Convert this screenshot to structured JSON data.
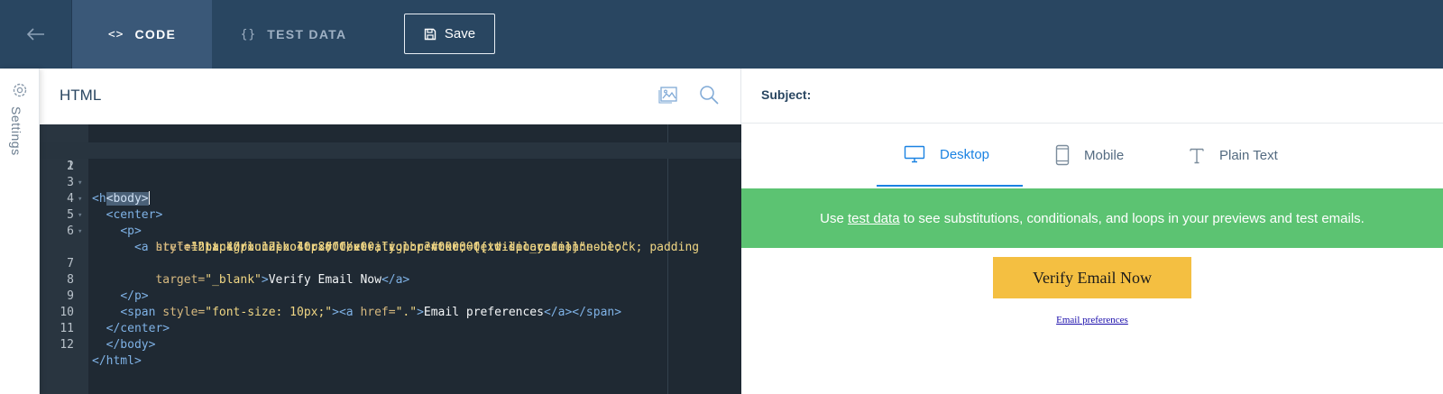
{
  "topbar": {
    "tabs": [
      {
        "label": "CODE",
        "icon": "<>"
      },
      {
        "label": "TEST DATA",
        "icon": "{}"
      }
    ],
    "save_label": "Save"
  },
  "sidebar": {
    "settings_label": "Settings"
  },
  "editor": {
    "title": "HTML",
    "line_numbers": [
      "1",
      "2",
      "3",
      "4",
      "5",
      "6",
      "",
      "7",
      "8",
      "9",
      "10",
      "11",
      "12"
    ]
  },
  "preview": {
    "subject_label": "Subject:",
    "tabs": [
      {
        "label": "Desktop",
        "icon": "desktop-icon",
        "active": true
      },
      {
        "label": "Mobile",
        "icon": "mobile-icon",
        "active": false
      },
      {
        "label": "Plain Text",
        "icon": "text-icon",
        "active": false
      }
    ],
    "banner": {
      "prefix": "Use ",
      "link": "test data",
      "suffix": " to see substitutions, conditionals, and loops in your previews and test emails."
    },
    "email": {
      "button_label": "Verify Email Now",
      "preferences_link": "Email preferences"
    }
  },
  "colors": {
    "topbar_bg": "#294661",
    "active_tab_bg": "#3a5878",
    "accent_blue": "#1a82e2",
    "banner_green": "#5cc372",
    "email_button_yellow": "#f4bf41",
    "editor_bg": "#1f2933"
  }
}
